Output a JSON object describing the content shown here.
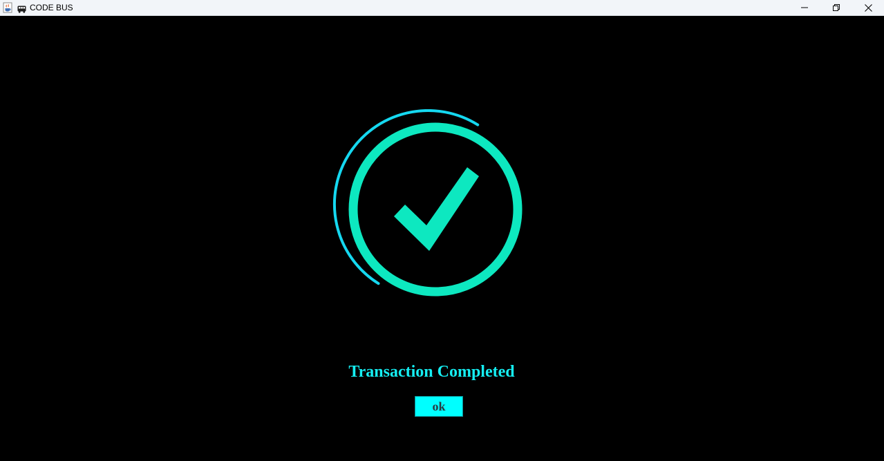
{
  "window": {
    "title": "CODE BUS",
    "app_icon": "java-coffee-icon",
    "title_icon": "bus-icon",
    "controls": {
      "minimize_icon": "minimize-icon",
      "maximize_icon": "restore-icon",
      "close_icon": "close-icon"
    }
  },
  "main": {
    "status_icon": "checkmark-circle-icon",
    "message": "Transaction Completed",
    "ok_label": "ok"
  },
  "colors": {
    "background": "#000000",
    "check_green": "#0de8c0",
    "ring_blue": "#15d8f0",
    "message_text": "#15eef2",
    "button_bg": "#00ffff",
    "button_text": "#2b3a42",
    "titlebar_bg": "#f2f5f9"
  }
}
